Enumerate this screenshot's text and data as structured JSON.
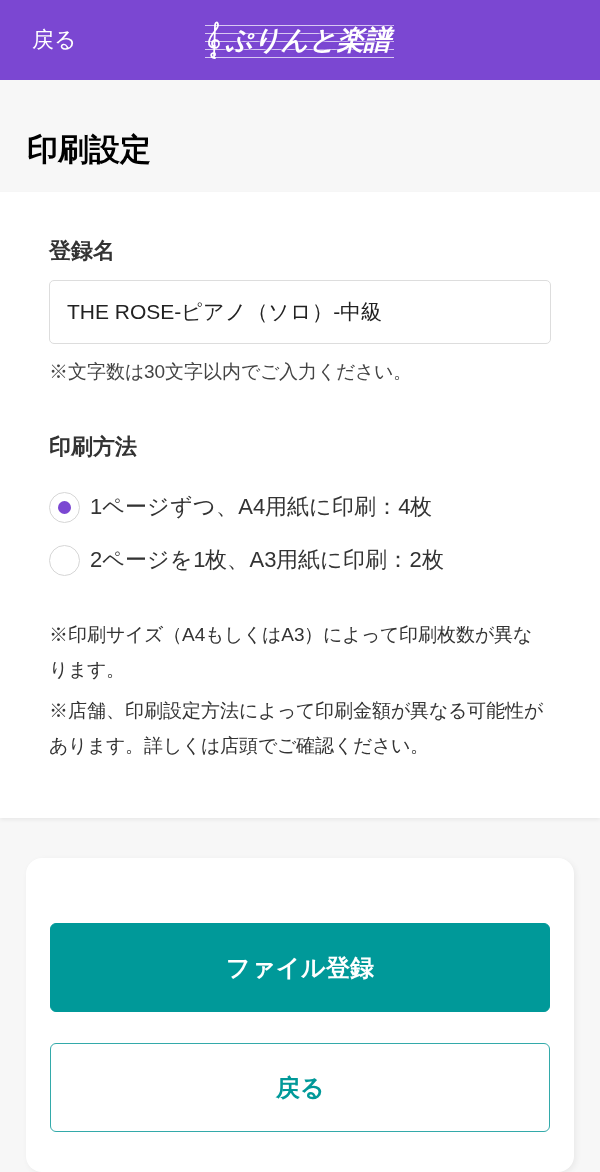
{
  "header": {
    "back_link": "戻る",
    "logo": "ぷりんと楽譜"
  },
  "page_title": "印刷設定",
  "form": {
    "name_field": {
      "label": "登録名",
      "value": "THE ROSE-ピアノ（ソロ）-中級",
      "hint": "※文字数は30文字以内でご入力ください。"
    },
    "print_method": {
      "label": "印刷方法",
      "options": [
        {
          "label": "1ページずつ、A4用紙に印刷：4枚",
          "selected": true
        },
        {
          "label": "2ページを1枚、A3用紙に印刷：2枚",
          "selected": false
        }
      ]
    },
    "notes": [
      "※印刷サイズ（A4もしくはA3）によって印刷枚数が異なります。",
      "※店舗、印刷設定方法によって印刷金額が異なる可能性があります。詳しくは店頭でご確認ください。"
    ]
  },
  "actions": [
    {
      "kind": "primary",
      "label": "ファイル登録"
    },
    {
      "kind": "secondary",
      "label": "戻る"
    }
  ]
}
